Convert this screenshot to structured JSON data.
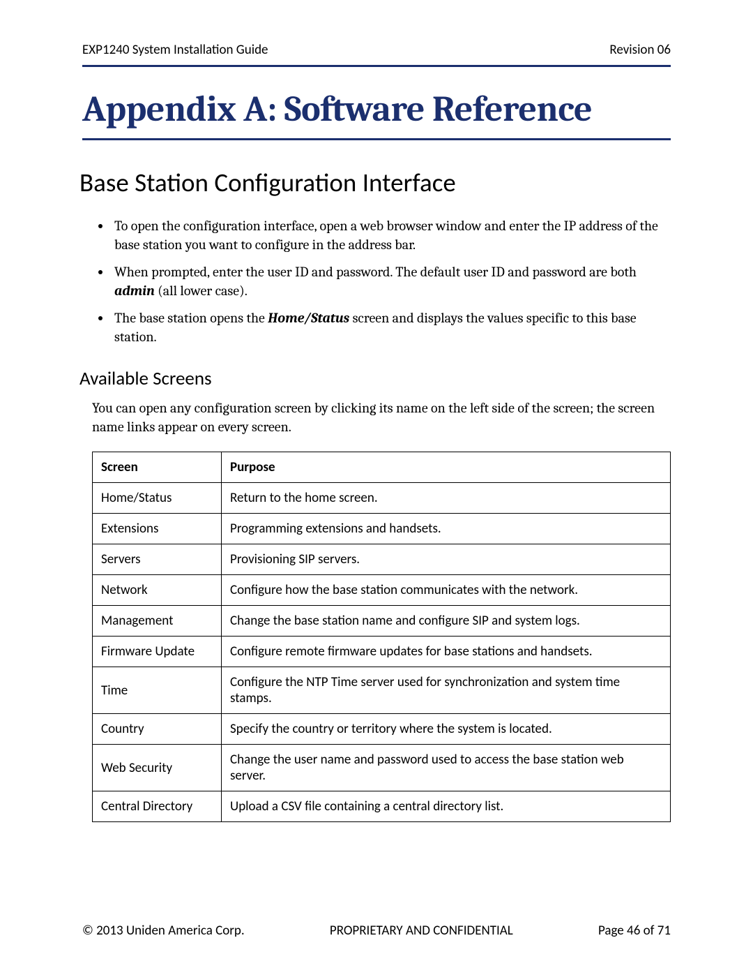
{
  "header": {
    "doc_title": "EXP1240 System Installation Guide",
    "revision": "Revision 06"
  },
  "title": "Appendix A: Software Reference",
  "h2": "Base Station Configuration Interface",
  "bullets": {
    "b1_part1": "To open the configuration interface, open a web browser window and enter the IP address of the base station you want to configure in the address bar.",
    "b2_part1": "When prompted, enter the user ID and password. The default user ID and password are both ",
    "b2_bold_italic": "admin",
    "b2_part2": " (all lower case).",
    "b3_part1": "The base station opens the ",
    "b3_bold_italic": "Home/Status",
    "b3_part2": " screen and displays the values specific to this base station."
  },
  "h3": "Available Screens",
  "intro_para": "You can open any configuration screen by clicking its name on the left side of the screen; the screen name links appear on every screen.",
  "table": {
    "headers": {
      "col1": "Screen",
      "col2": "Purpose"
    },
    "rows": [
      {
        "screen": "Home/Status",
        "purpose": "Return to the home screen."
      },
      {
        "screen": "Extensions",
        "purpose": "Programming extensions and handsets."
      },
      {
        "screen": "Servers",
        "purpose": "Provisioning SIP servers."
      },
      {
        "screen": "Network",
        "purpose": "Configure how the base station communicates with the network."
      },
      {
        "screen": "Management",
        "purpose": "Change the base station name and configure SIP and system logs."
      },
      {
        "screen": "Firmware Update",
        "purpose": "Configure remote firmware updates for base stations and handsets."
      },
      {
        "screen": "Time",
        "purpose": "Configure the NTP Time server used for synchronization and system time stamps."
      },
      {
        "screen": "Country",
        "purpose": "Specify the country or territory where the system is located."
      },
      {
        "screen": "Web Security",
        "purpose": "Change the user name and password used to access the base station web server."
      },
      {
        "screen": "Central Directory",
        "purpose": "Upload a CSV file containing a central directory list."
      }
    ]
  },
  "footer": {
    "copyright": "© 2013 Uniden America Corp.",
    "confidential": "PROPRIETARY AND CONFIDENTIAL",
    "page": "Page 46 of 71"
  }
}
